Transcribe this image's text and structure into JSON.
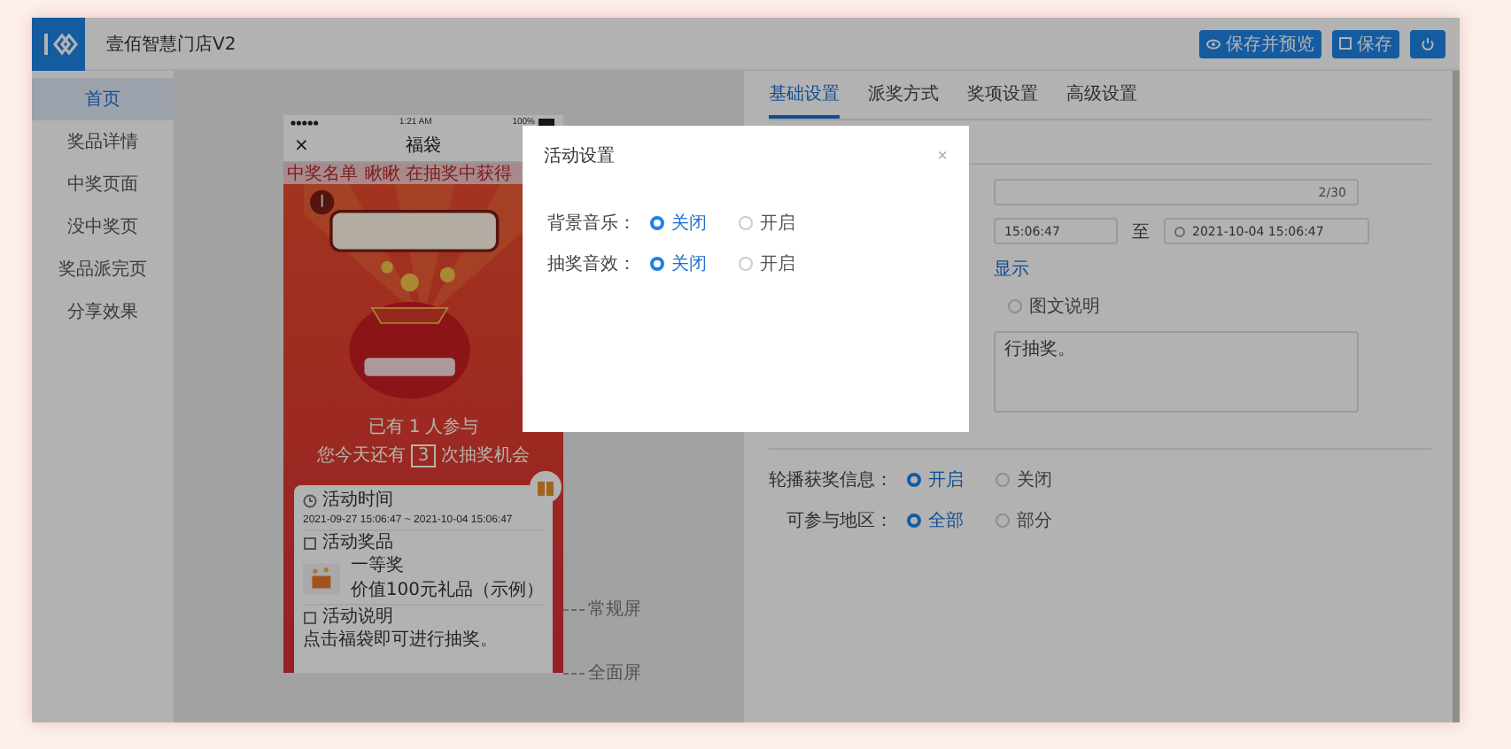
{
  "header": {
    "title": "壹佰智慧门店V2",
    "buttons": [
      {
        "kind": "preview",
        "label": "保存并预览"
      },
      {
        "kind": "save",
        "label": "保存"
      },
      {
        "kind": "power"
      }
    ]
  },
  "sidebar": {
    "items": [
      {
        "label": "首页",
        "selected": true
      },
      {
        "label": "奖品详情",
        "selected": false
      },
      {
        "label": "中奖页面",
        "selected": false
      },
      {
        "label": "没中奖页",
        "selected": false
      },
      {
        "label": "奖品派完页",
        "selected": false
      },
      {
        "label": "分享效果",
        "selected": false
      }
    ]
  },
  "phone": {
    "time": "1:21 AM",
    "battery": "100%",
    "nav_close": "×",
    "nav_title": "福袋",
    "marquee": [
      "中奖名单",
      "瞅瞅 在抽奖中获得"
    ],
    "participants": {
      "prefix": "已有",
      "count": "1",
      "suffix": "人参与"
    },
    "chances": {
      "prefix": "您今天还有",
      "count": "3",
      "suffix": "次抽奖机会"
    },
    "sections": [
      {
        "kind": "time",
        "title": "活动时间",
        "text": "2021-09-27 15:06:47 ~ 2021-10-04 15:06:47"
      },
      {
        "kind": "prize",
        "title": "活动奖品",
        "prize_name": "一等奖",
        "prize_value": "价值100元礼品（示例）"
      },
      {
        "kind": "description",
        "title": "活动说明",
        "text": "点击福袋即可进行抽奖。"
      }
    ],
    "screen_markers": [
      "常规屏",
      "全面屏"
    ]
  },
  "tabs": [
    {
      "label": "基础设置",
      "selected": true
    },
    {
      "label": "派奖方式",
      "selected": false
    },
    {
      "label": "奖项设置",
      "selected": false
    },
    {
      "label": "高级设置",
      "selected": false
    }
  ],
  "form": {
    "name_counter": "2/30",
    "start_time": "15:06:47",
    "range_separator": "至",
    "end_time": "2021-10-04 15:06:47",
    "link": "显示",
    "description_type": {
      "label": "图文说明",
      "selected": false
    },
    "description": "行抽奖。",
    "options": [
      {
        "label": "轮播获奖信息：",
        "choices": [
          {
            "label": "开启",
            "selected": true
          },
          {
            "label": "关闭",
            "selected": false
          }
        ]
      },
      {
        "label": "可参与地区：",
        "choices": [
          {
            "label": "全部",
            "selected": true
          },
          {
            "label": "部分",
            "selected": false
          }
        ]
      }
    ]
  },
  "modal": {
    "title": "活动设置",
    "close": "×",
    "rows": [
      {
        "label": "背景音乐：",
        "choices": [
          {
            "label": "关闭",
            "selected": true
          },
          {
            "label": "开启",
            "selected": false
          }
        ]
      },
      {
        "label": "抽奖音效：",
        "choices": [
          {
            "label": "关闭",
            "selected": true
          },
          {
            "label": "开启",
            "selected": false
          }
        ]
      }
    ]
  }
}
